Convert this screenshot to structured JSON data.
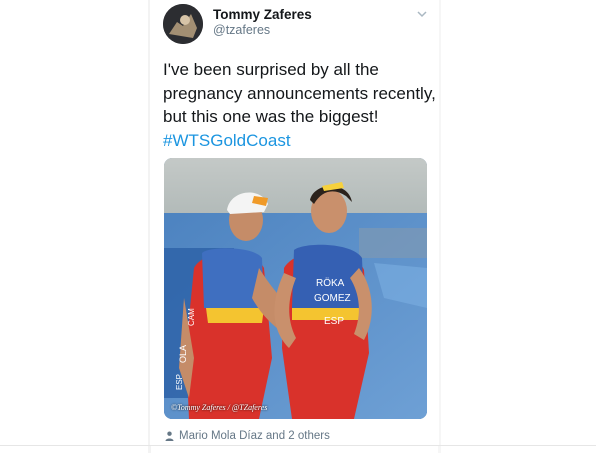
{
  "tweet": {
    "display_name": "Tommy Zaferes",
    "handle": "@tzaferes",
    "text_lines": [
      "I've been surprised by all the",
      "pregnancy announcements recently,",
      "but this one was the biggest!"
    ],
    "hashtag": "#WTSGoldCoast",
    "photo": {
      "watermark": "©Tommy Zaferes / @TZaferes",
      "bib_left": [
        "CAM",
        "OLA",
        "ESP"
      ],
      "bib_right": [
        "RÖKA",
        "GOMEZ",
        "ESP"
      ]
    },
    "tagged": "Mario Mola Díaz and 2 others"
  },
  "icons": {
    "avatar": "avatar",
    "menu": "chevron-down-icon",
    "tag": "person-icon"
  },
  "colors": {
    "text": "#14171a",
    "secondary": "#657786",
    "link": "#1b95e0"
  }
}
